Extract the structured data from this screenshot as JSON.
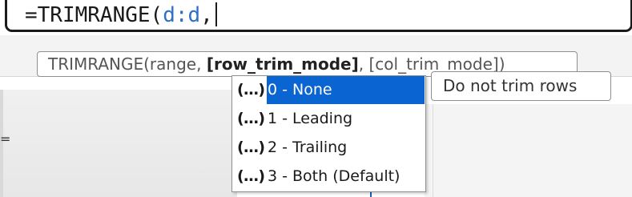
{
  "formula_bar": {
    "prefix": "=TRIMRANGE(",
    "reference": "d:d",
    "suffix": ","
  },
  "function_tooltip": {
    "start": "TRIMRANGE(range, ",
    "current_argument": "[row_trim_mode]",
    "end": ", [col_trim_mode])"
  },
  "dropdown": {
    "items": [
      {
        "icon": "(...)",
        "label": "0 - None",
        "selected": true
      },
      {
        "icon": "(...)",
        "label": "1 - Leading",
        "selected": false
      },
      {
        "icon": "(...)",
        "label": "2 - Trailing",
        "selected": false
      },
      {
        "icon": "(...)",
        "label": "3 - Both (Default)",
        "selected": false
      }
    ]
  },
  "description_tooltip": {
    "text": "Do not trim rows"
  },
  "colors": {
    "selection": "#0a64d1",
    "reference": "#2f6fc5"
  }
}
